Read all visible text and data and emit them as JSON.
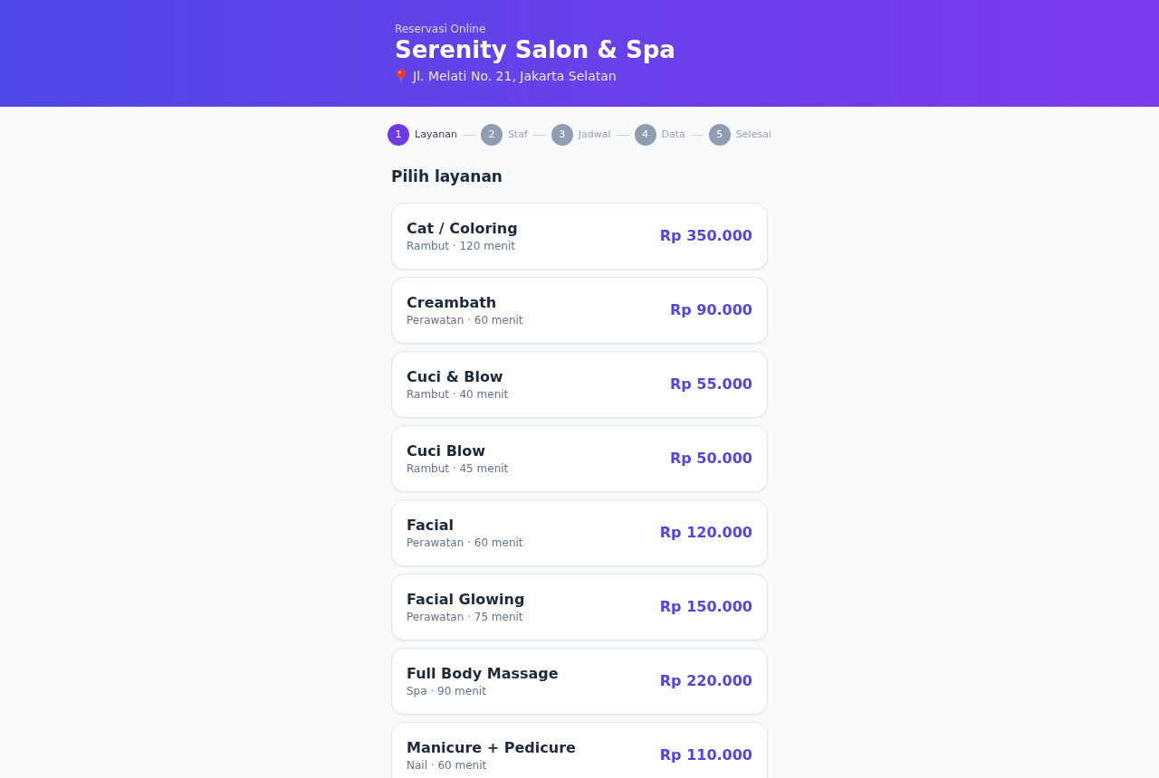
{
  "header": {
    "eyebrow": "Reservasi Online",
    "title": "Serenity Salon & Spa",
    "address": "Jl. Melati No. 21, Jakarta Selatan"
  },
  "steps": [
    {
      "number": "1",
      "label": "Layanan",
      "selected": true
    },
    {
      "number": "2",
      "label": "Staf",
      "selected": false
    },
    {
      "number": "3",
      "label": "Jadwal",
      "selected": false
    },
    {
      "number": "4",
      "label": "Data",
      "selected": false
    },
    {
      "number": "5",
      "label": "Selesai",
      "selected": false
    }
  ],
  "heading": "Pilih layanan",
  "services": [
    {
      "name": "Cat / Coloring",
      "details": "Rambut · 120 menit",
      "price": "Rp 350.000"
    },
    {
      "name": "Creambath",
      "details": "Perawatan · 60 menit",
      "price": "Rp 90.000"
    },
    {
      "name": "Cuci & Blow",
      "details": "Rambut · 40 menit",
      "price": "Rp 55.000"
    },
    {
      "name": "Cuci Blow",
      "details": "Rambut · 45 menit",
      "price": "Rp 50.000"
    },
    {
      "name": "Facial",
      "details": "Perawatan · 60 menit",
      "price": "Rp 120.000"
    },
    {
      "name": "Facial Glowing",
      "details": "Perawatan · 75 menit",
      "price": "Rp 150.000"
    },
    {
      "name": "Full Body Massage",
      "details": "Spa · 90 menit",
      "price": "Rp 220.000"
    },
    {
      "name": "Manicure + Pedicure",
      "details": "Nail · 60 menit",
      "price": "Rp 110.000"
    }
  ]
}
